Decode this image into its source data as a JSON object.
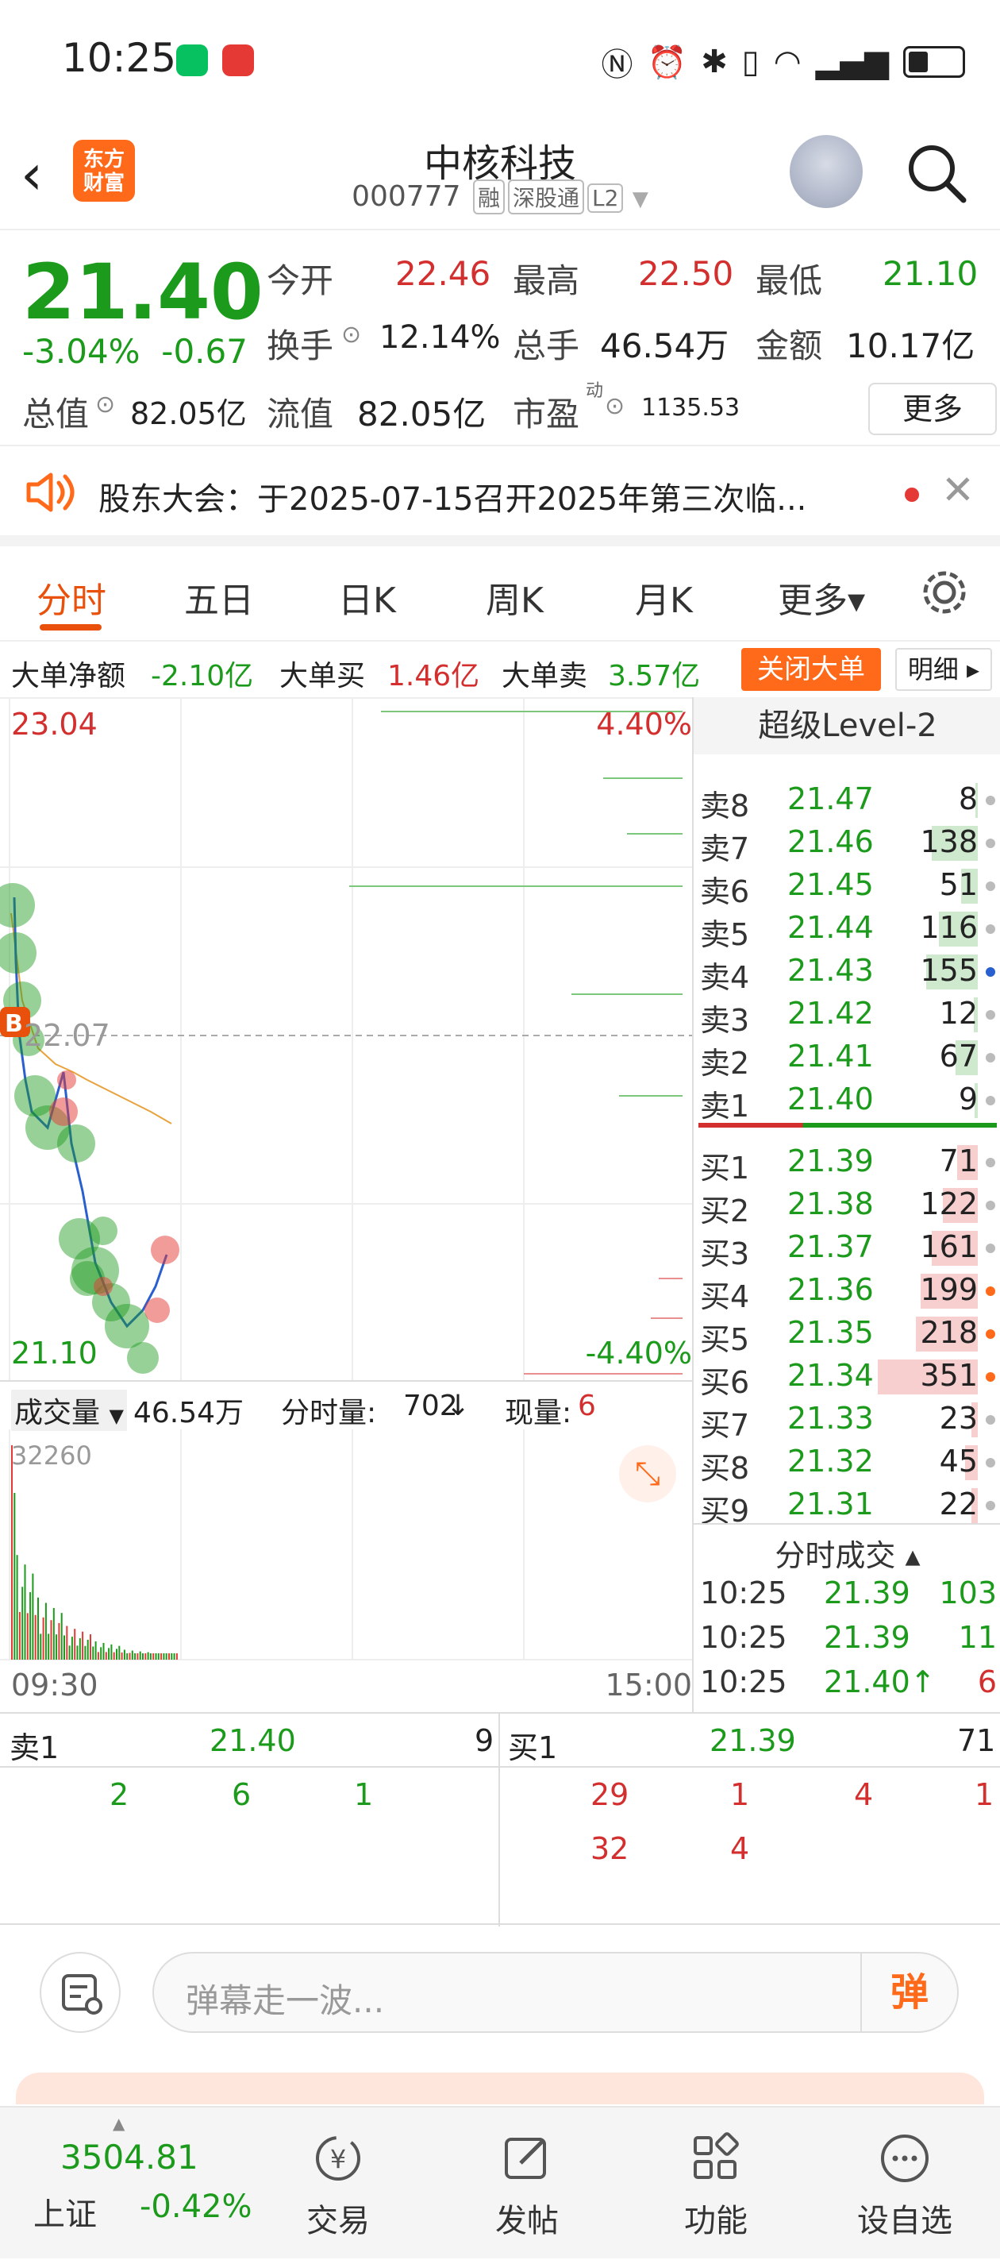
{
  "status_bar": {
    "time": "10:25"
  },
  "header": {
    "title": "中核科技",
    "code": "000777",
    "tags": [
      "融",
      "深股通",
      "L2"
    ],
    "logo_line1": "东方",
    "logo_line2": "财富"
  },
  "quote": {
    "price": "21.40",
    "change_pct": "-3.04%",
    "change": "-0.67",
    "open_label": "今开",
    "open": "22.46",
    "high_label": "最高",
    "high": "22.50",
    "low_label": "最低",
    "low": "21.10",
    "turnover_label": "换手",
    "turnover": "12.14%",
    "volume_label": "总手",
    "volume": "46.54万",
    "amount_label": "金额",
    "amount": "10.17亿",
    "total_cap_label": "总值",
    "total_cap": "82.05亿",
    "float_cap_label": "流值",
    "float_cap": "82.05亿",
    "pe_label": "市盈",
    "pe_sup": "动",
    "pe": "1135.53",
    "more": "更多"
  },
  "notice": {
    "text": "股东大会：于2025-07-15召开2025年第三次临..."
  },
  "tabs": [
    "分时",
    "五日",
    "日K",
    "周K",
    "月K",
    "更多▾"
  ],
  "big_order": {
    "net_label": "大单净额",
    "net": "-2.10亿",
    "buy_label": "大单买",
    "buy": "1.46亿",
    "sell_label": "大单卖",
    "sell": "3.57亿",
    "close_btn": "关闭大单",
    "detail_btn": "明细 ▸"
  },
  "chart": {
    "price_high": "23.04",
    "price_low": "21.10",
    "pct_high": "4.40%",
    "pct_low": "-4.40%",
    "prev_close": "22.07",
    "b_marker": "B",
    "time_start": "09:30",
    "time_end": "15:00"
  },
  "volume": {
    "label": "成交量",
    "total": "46.54万",
    "min_label": "分时量:",
    "min_val": "702",
    "min_arrow": "↓",
    "cur_label": "现量:",
    "cur_val": "6",
    "axis_max": "32260"
  },
  "level2": {
    "title": "超级Level-2",
    "asks": [
      {
        "name": "卖8",
        "price": "21.47",
        "qty": "8"
      },
      {
        "name": "卖7",
        "price": "21.46",
        "qty": "138"
      },
      {
        "name": "卖6",
        "price": "21.45",
        "qty": "51"
      },
      {
        "name": "卖5",
        "price": "21.44",
        "qty": "116"
      },
      {
        "name": "卖4",
        "price": "21.43",
        "qty": "155"
      },
      {
        "name": "卖3",
        "price": "21.42",
        "qty": "12"
      },
      {
        "name": "卖2",
        "price": "21.41",
        "qty": "67"
      },
      {
        "name": "卖1",
        "price": "21.40",
        "qty": "9"
      }
    ],
    "bids": [
      {
        "name": "买1",
        "price": "21.39",
        "qty": "71"
      },
      {
        "name": "买2",
        "price": "21.38",
        "qty": "122"
      },
      {
        "name": "买3",
        "price": "21.37",
        "qty": "161"
      },
      {
        "name": "买4",
        "price": "21.36",
        "qty": "199"
      },
      {
        "name": "买5",
        "price": "21.35",
        "qty": "218"
      },
      {
        "name": "买6",
        "price": "21.34",
        "qty": "351"
      },
      {
        "name": "买7",
        "price": "21.33",
        "qty": "23"
      },
      {
        "name": "买8",
        "price": "21.32",
        "qty": "45"
      },
      {
        "name": "买9",
        "price": "21.31",
        "qty": "22"
      }
    ],
    "ticks_title": "分时成交 ▴",
    "ticks": [
      {
        "time": "10:25",
        "price": "21.39",
        "qty": "103"
      },
      {
        "time": "10:25",
        "price": "21.39",
        "qty": "11"
      },
      {
        "time": "10:25",
        "price": "21.40↑",
        "qty": "6"
      }
    ]
  },
  "queue": {
    "sell_label": "卖1",
    "sell_price": "21.40",
    "sell_qty": "9",
    "buy_label": "买1",
    "buy_price": "21.39",
    "buy_qty": "71",
    "sell_orders": [
      "2",
      "6",
      "1"
    ],
    "buy_orders": [
      "29",
      "1",
      "4",
      "1",
      "32",
      "4"
    ]
  },
  "danmu": {
    "placeholder": "弹幕走一波...",
    "button": "弹"
  },
  "tabbar": {
    "index_value": "3504.81",
    "index_name": "上证",
    "index_change": "-0.42%",
    "items": [
      "交易",
      "发帖",
      "功能",
      "设自选"
    ]
  }
}
